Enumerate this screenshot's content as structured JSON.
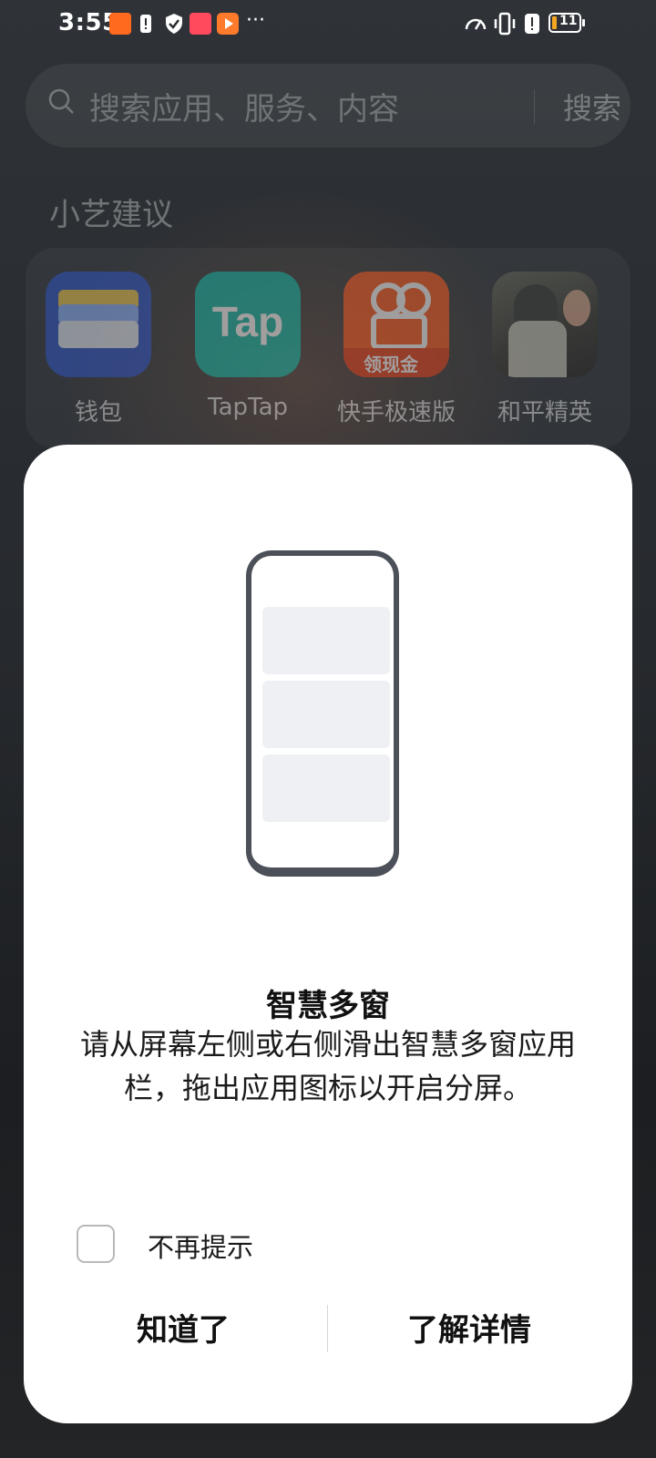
{
  "status_bar": {
    "time": "3:55",
    "battery": "11",
    "overflow": "···"
  },
  "search": {
    "placeholder": "搜索应用、服务、内容",
    "button": "搜索"
  },
  "suggestions": {
    "title": "小艺建议",
    "apps": [
      {
        "label": "钱包",
        "icon": "wallet-icon"
      },
      {
        "label": "TapTap",
        "icon": "taptap-icon",
        "icon_text": "Tap"
      },
      {
        "label": "快手极速版",
        "icon": "kuaishou-lite-icon",
        "badge": "领现金"
      },
      {
        "label": "和平精英",
        "icon": "peace-elite-icon"
      }
    ]
  },
  "dialog": {
    "title": "智慧多窗",
    "body": "请从屏幕左侧或右侧滑出智慧多窗应用栏，拖出应用图标以开启分屏。",
    "checkbox_label": "不再提示",
    "checkbox_checked": false,
    "left_button": "知道了",
    "right_button": "了解详情"
  },
  "colors": {
    "taptap": "#14b9a7",
    "kuaishou": "#ff5a1f",
    "wallet": "#2f55c8"
  }
}
